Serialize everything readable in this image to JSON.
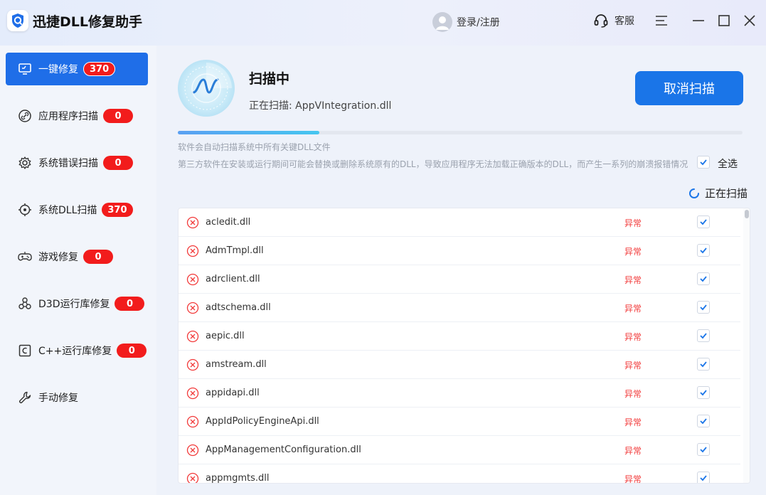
{
  "app": {
    "title": "迅捷DLL修复助手",
    "login_label": "登录/注册",
    "support_label": "客服"
  },
  "sidebar": {
    "items": [
      {
        "label": "一键修复",
        "badge": "370",
        "icon": "monitor-icon",
        "active": true
      },
      {
        "label": "应用程序扫描",
        "badge": "0",
        "icon": "link-icon",
        "active": false
      },
      {
        "label": "系统错误扫描",
        "badge": "0",
        "icon": "gear-icon",
        "active": false
      },
      {
        "label": "系统DLL扫描",
        "badge": "370",
        "icon": "target-icon",
        "active": false
      },
      {
        "label": "游戏修复",
        "badge": "0",
        "icon": "gamepad-icon",
        "active": false
      },
      {
        "label": "D3D运行库修复",
        "badge": "0",
        "icon": "nodes-icon",
        "active": false
      },
      {
        "label": "C++运行库修复",
        "badge": "0",
        "icon": "c-box-icon",
        "active": false
      },
      {
        "label": "手动修复",
        "badge": null,
        "icon": "wrench-icon",
        "active": false
      }
    ]
  },
  "scan": {
    "title": "扫描中",
    "status_text": "正在扫描: AppVIntegration.dll",
    "cancel_label": "取消扫描",
    "progress": 0.25,
    "description1": "软件会自动扫描系统中所有关键DLL文件",
    "description2": "第三方软件在安装或运行期间可能会替换或删除系统原有的DLL，导致应用程序无法加载正确版本的DLL，而产生一系列的崩溃报错情况",
    "select_all_label": "全选",
    "select_all_checked": true,
    "scanning_label": "正在扫描"
  },
  "colors": {
    "accent": "#1a75e8",
    "badge": "#f21c1c",
    "error": "#f23a3a"
  },
  "files": [
    {
      "name": "acledit.dll",
      "status": "异常",
      "checked": true
    },
    {
      "name": "AdmTmpl.dll",
      "status": "异常",
      "checked": true
    },
    {
      "name": "adrclient.dll",
      "status": "异常",
      "checked": true
    },
    {
      "name": "adtschema.dll",
      "status": "异常",
      "checked": true
    },
    {
      "name": "aepic.dll",
      "status": "异常",
      "checked": true
    },
    {
      "name": "amstream.dll",
      "status": "异常",
      "checked": true
    },
    {
      "name": "appidapi.dll",
      "status": "异常",
      "checked": true
    },
    {
      "name": "AppIdPolicyEngineApi.dll",
      "status": "异常",
      "checked": true
    },
    {
      "name": "AppManagementConfiguration.dll",
      "status": "异常",
      "checked": true
    },
    {
      "name": "appmgmts.dll",
      "status": "异常",
      "checked": true
    }
  ]
}
